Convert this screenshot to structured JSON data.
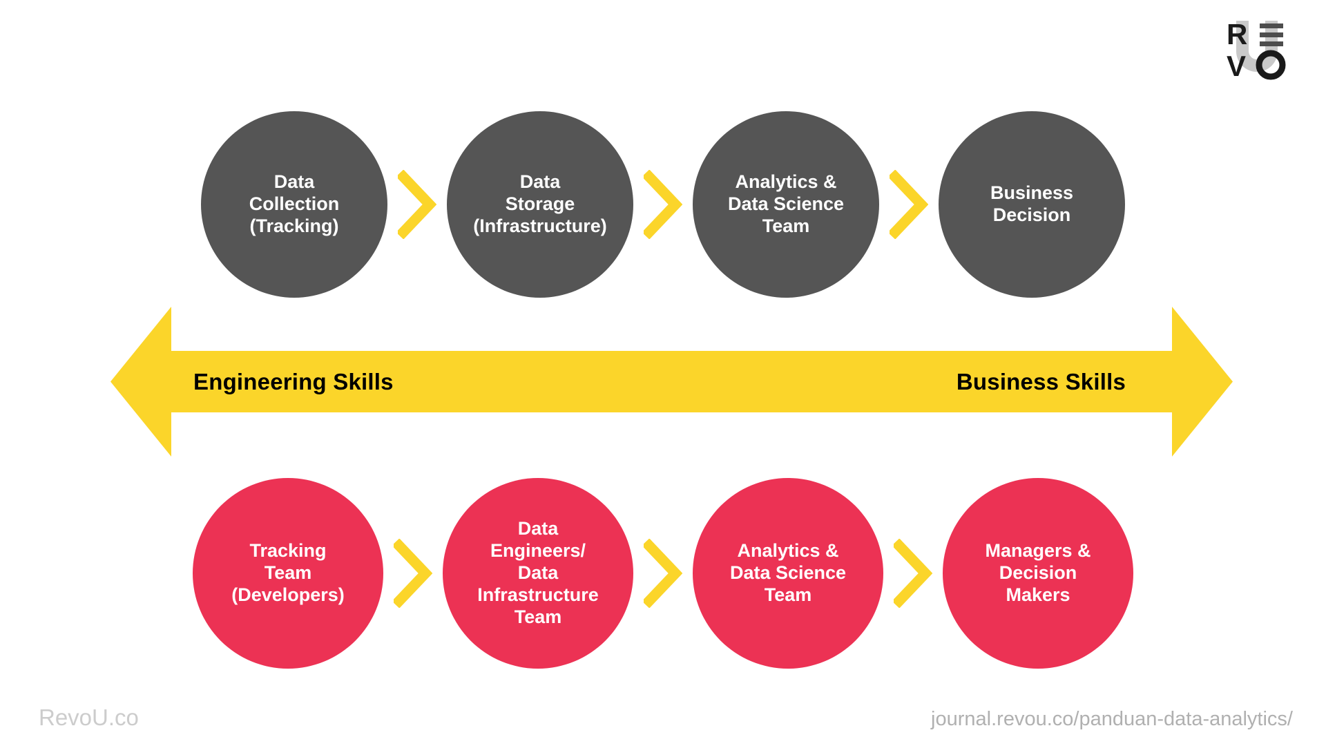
{
  "logo": {
    "name": "revou-logo",
    "letters": [
      "R",
      "V",
      "O"
    ],
    "wordmark": "REVO U"
  },
  "top_row": {
    "nodes": [
      {
        "label": "Data\nCollection\n(Tracking)"
      },
      {
        "label": "Data\nStorage\n(Infrastructure)"
      },
      {
        "label": "Analytics &\nData Science\nTeam"
      },
      {
        "label": "Business\nDecision"
      }
    ],
    "separator_icon": "chevron-right-icon",
    "color": "#555555"
  },
  "bottom_row": {
    "nodes": [
      {
        "label": "Tracking\nTeam\n(Developers)"
      },
      {
        "label": "Data\nEngineers/\nData\nInfrastructure\nTeam"
      },
      {
        "label": "Analytics &\nData Science\nTeam"
      },
      {
        "label": "Managers &\nDecision\nMakers"
      }
    ],
    "separator_icon": "chevron-right-icon",
    "color": "#EC3254"
  },
  "skills_arrow": {
    "left_label": "Engineering Skills",
    "right_label": "Business Skills",
    "color": "#FBD52A",
    "icon": "double-headed-arrow-icon"
  },
  "footer": {
    "brand": "RevoU.co",
    "source_url": "journal.revou.co/panduan-data-analytics/"
  },
  "colors": {
    "background": "#FFFFFF",
    "gray_node": "#555555",
    "red_node": "#EC3254",
    "yellow": "#FBD52A",
    "footer_text": "#C3C3C3"
  }
}
